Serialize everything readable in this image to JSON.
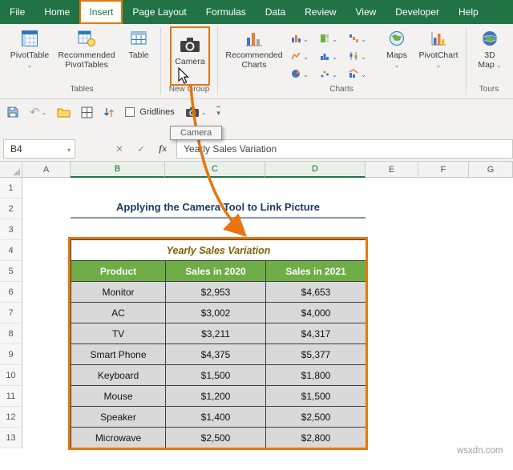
{
  "tabs": [
    "File",
    "Home",
    "Insert",
    "Page Layout",
    "Formulas",
    "Data",
    "Review",
    "View",
    "Developer",
    "Help"
  ],
  "active_tab": "Insert",
  "ribbon": {
    "groups": {
      "tables": {
        "label": "Tables",
        "pivottable": "PivotTable",
        "recommended_pivottables1": "Recommended",
        "recommended_pivottables2": "PivotTables",
        "table": "Table"
      },
      "new_group": {
        "label": "New Group",
        "camera": "Camera"
      },
      "charts": {
        "label": "Charts",
        "recommended_charts1": "Recommended",
        "recommended_charts2": "Charts",
        "maps": "Maps",
        "pivotchart": "PivotChart"
      },
      "tours": {
        "label": "Tours",
        "map3d1": "3D",
        "map3d2": "Map"
      }
    }
  },
  "quick_access": {
    "gridlines_label": "Gridlines",
    "tooltip": "Camera"
  },
  "formula_bar": {
    "name_box": "B4",
    "formula_text": "Yearly Sales Variation"
  },
  "grid": {
    "columns": [
      "A",
      "B",
      "C",
      "D",
      "E",
      "F",
      "G"
    ],
    "selected_columns": [
      "B",
      "C",
      "D"
    ],
    "rows": [
      "1",
      "2",
      "3",
      "4",
      "5",
      "6",
      "7",
      "8",
      "9",
      "10",
      "11",
      "12",
      "13"
    ]
  },
  "sheet": {
    "title": "Applying the Camera Tool to Link Picture",
    "table": {
      "caption": "Yearly Sales Variation",
      "headers": [
        "Product",
        "Sales in 2020",
        "Sales in 2021"
      ],
      "rows": [
        [
          "Monitor",
          "$2,953",
          "$4,653"
        ],
        [
          "AC",
          "$3,002",
          "$4,000"
        ],
        [
          "TV",
          "$3,211",
          "$4,317"
        ],
        [
          "Smart Phone",
          "$4,375",
          "$5,377"
        ],
        [
          "Keyboard",
          "$1,500",
          "$1,800"
        ],
        [
          "Mouse",
          "$1,200",
          "$1,500"
        ],
        [
          "Speaker",
          "$1,400",
          "$2,500"
        ],
        [
          "Microwave",
          "$2,500",
          "$2,800"
        ]
      ]
    }
  },
  "watermark": "wsxdn.com",
  "colors": {
    "excel_green": "#217346",
    "highlight_orange": "#E8750D",
    "table_header_green": "#6FAD47",
    "cell_gray": "#D9D9D9",
    "caption_olive": "#7F6000",
    "title_navy": "#1F3864"
  }
}
